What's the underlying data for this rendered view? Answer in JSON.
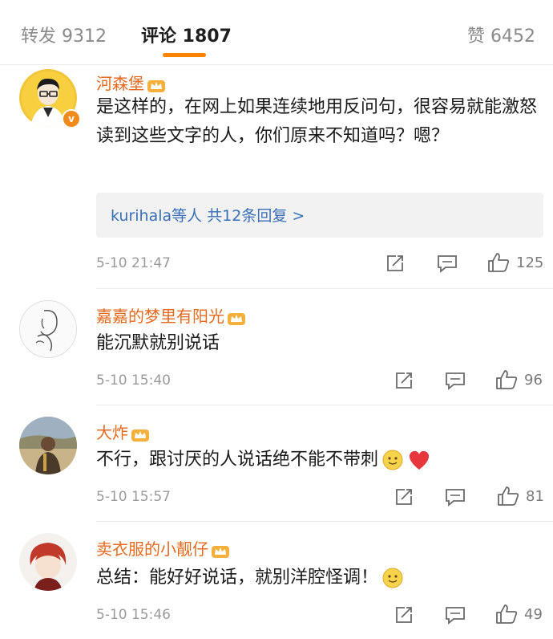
{
  "tabs": [
    {
      "label": "转发 9312"
    },
    {
      "label": "评论 1807"
    },
    {
      "label": "赞 6452"
    }
  ],
  "comments": [
    {
      "name": "河森堡",
      "text": "是这样的，在网上如果连续地用反问句，很容易就能激怒读到这些文字的人，你们原来不知道吗？嗯？",
      "replies": "kurihala等人  共12条回复 >",
      "time": "5-10 21:47",
      "likes": "125"
    },
    {
      "name": "嘉嘉的梦里有阳光",
      "text": "能沉默就别说话",
      "time": "5-10 15:40",
      "likes": "96"
    },
    {
      "name": "大炸",
      "text": "不行，跟讨厌的人说话绝不能不带刺",
      "time": "5-10 15:57",
      "likes": "81"
    },
    {
      "name": "卖衣服的小靓仔",
      "text": "总结：能好好说话，就别洋腔怪调！",
      "time": "5-10 15:46",
      "likes": "49"
    }
  ],
  "icons": {
    "verified": "verified-badge-icon",
    "crown": "member-crown-icon",
    "share": "share-icon",
    "reply": "reply-icon",
    "like": "like-icon"
  },
  "colors": {
    "accent": "#ff8200",
    "name": "#e56a1e",
    "link": "#3a6fb7"
  }
}
